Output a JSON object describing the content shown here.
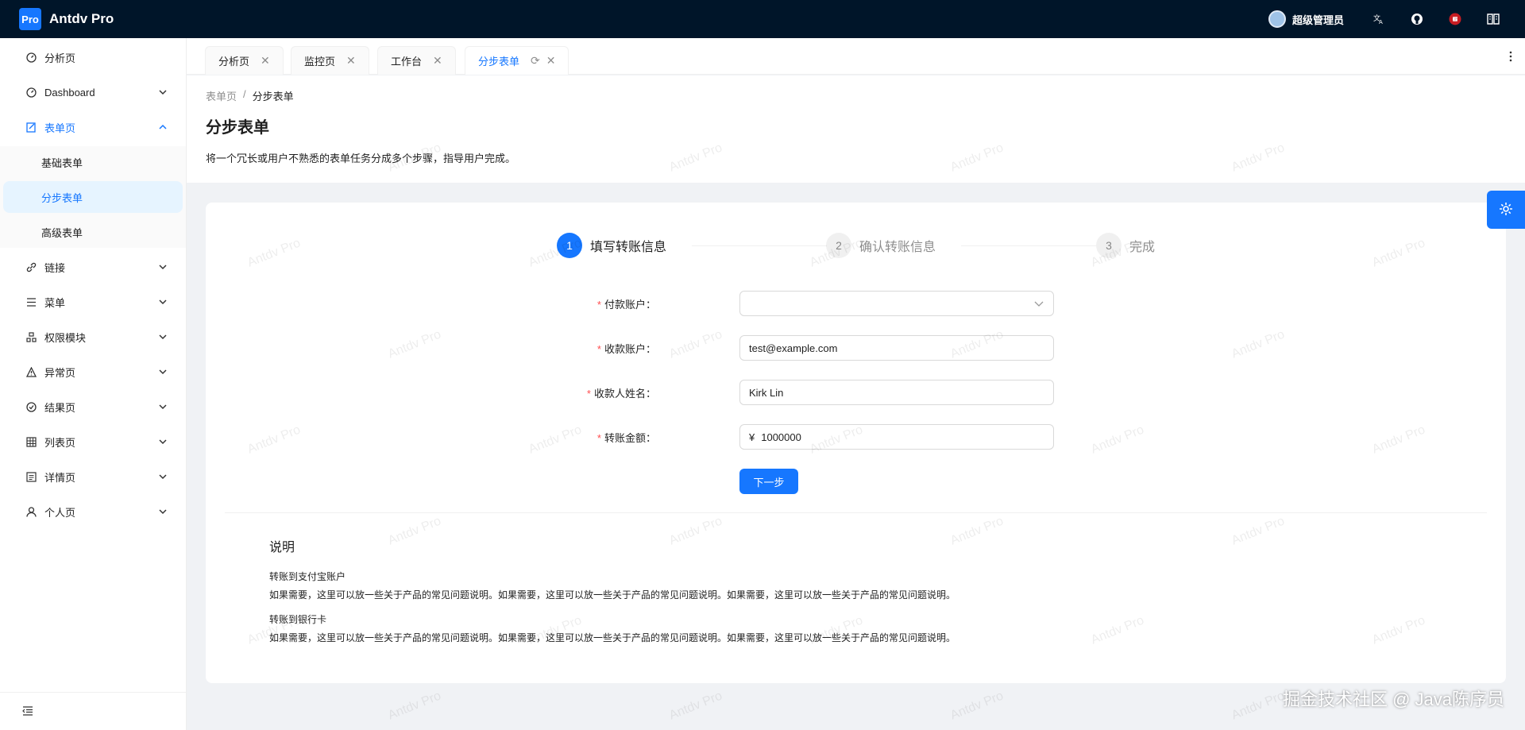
{
  "app": {
    "logo_text": "Pro",
    "title": "Antdv Pro"
  },
  "header": {
    "user_name": "超级管理员",
    "icons": [
      "translate-icon",
      "github-icon",
      "gitee-icon",
      "book-icon"
    ]
  },
  "sidebar": {
    "items": [
      {
        "label": "分析页",
        "icon": "dashboard-icon",
        "has_arrow": false
      },
      {
        "label": "Dashboard",
        "icon": "dashboard-icon",
        "has_arrow": true
      },
      {
        "label": "表单页",
        "icon": "form-icon",
        "has_arrow": true,
        "open": true
      },
      {
        "label": "链接",
        "icon": "link-icon",
        "has_arrow": true
      },
      {
        "label": "菜单",
        "icon": "menu-icon",
        "has_arrow": true
      },
      {
        "label": "权限模块",
        "icon": "cluster-icon",
        "has_arrow": true
      },
      {
        "label": "异常页",
        "icon": "warning-icon",
        "has_arrow": true
      },
      {
        "label": "结果页",
        "icon": "check-circle-icon",
        "has_arrow": true
      },
      {
        "label": "列表页",
        "icon": "table-icon",
        "has_arrow": true
      },
      {
        "label": "详情页",
        "icon": "profile-icon",
        "has_arrow": true
      },
      {
        "label": "个人页",
        "icon": "user-icon",
        "has_arrow": true
      }
    ],
    "sub_items": [
      {
        "label": "基础表单",
        "active": false
      },
      {
        "label": "分步表单",
        "active": true
      },
      {
        "label": "高级表单",
        "active": false
      }
    ]
  },
  "tabs": [
    {
      "label": "分析页",
      "active": false
    },
    {
      "label": "监控页",
      "active": false
    },
    {
      "label": "工作台",
      "active": false
    },
    {
      "label": "分步表单",
      "active": true
    }
  ],
  "page": {
    "breadcrumb": [
      "表单页",
      "分步表单"
    ],
    "title": "分步表单",
    "description": "将一个冗长或用户不熟悉的表单任务分成多个步骤，指导用户完成。"
  },
  "steps": [
    {
      "num": "1",
      "title": "填写转账信息",
      "status": "active"
    },
    {
      "num": "2",
      "title": "确认转账信息",
      "status": "wait"
    },
    {
      "num": "3",
      "title": "完成",
      "status": "wait"
    }
  ],
  "form": {
    "pay_account_label": "付款账户",
    "pay_account_value": "",
    "receive_account_label": "收款账户",
    "receive_account_value": "test@example.com",
    "receiver_name_label": "收款人姓名",
    "receiver_name_value": "Kirk Lin",
    "amount_label": "转账金额",
    "amount_prefix": "¥",
    "amount_value": "1000000",
    "next_button": "下一步"
  },
  "explain": {
    "title": "说明",
    "sections": [
      {
        "heading": "转账到支付宝账户",
        "text": "如果需要，这里可以放一些关于产品的常见问题说明。如果需要，这里可以放一些关于产品的常见问题说明。如果需要，这里可以放一些关于产品的常见问题说明。"
      },
      {
        "heading": "转账到银行卡",
        "text": "如果需要，这里可以放一些关于产品的常见问题说明。如果需要，这里可以放一些关于产品的常见问题说明。如果需要，这里可以放一些关于产品的常见问题说明。"
      }
    ]
  },
  "watermark": "Antdv Pro",
  "footer_watermark": "掘金技术社区 @ Java陈序员",
  "colors": {
    "primary": "#1677ff",
    "header_bg": "#001529",
    "required": "#ff4d4f"
  }
}
